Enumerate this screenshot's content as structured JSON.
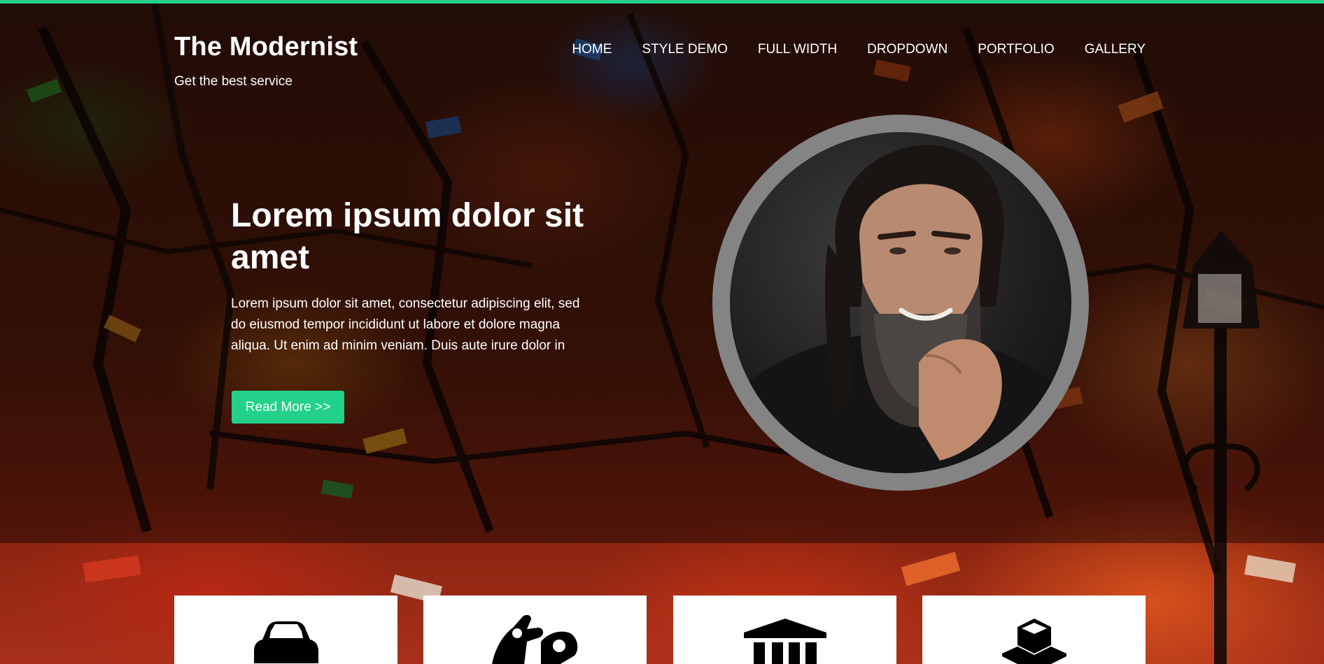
{
  "header": {
    "site_title": "The Modernist",
    "tagline": "Get the best service"
  },
  "nav": {
    "items": [
      "HOME",
      "STYLE DEMO",
      "FULL WIDTH",
      "DROPDOWN",
      "PORTFOLIO",
      "GALLERY"
    ]
  },
  "hero": {
    "heading": "Lorem ipsum dolor sit amet",
    "text": "Lorem ipsum dolor sit amet, consectetur adipiscing elit, sed do eiusmod tempor incididunt ut labore et dolore magna aliqua. Ut enim ad minim veniam. Duis aute irure dolor in",
    "button_label": "Read More >>",
    "portrait_icon": "bearded-man-portrait"
  },
  "features": {
    "cards": [
      {
        "icon": "car-icon"
      },
      {
        "icon": "hand-ok-icon"
      },
      {
        "icon": "bank-icon"
      },
      {
        "icon": "cubes-icon"
      }
    ]
  },
  "colors": {
    "accent": "#23d18b",
    "portrait_ring": "#848484",
    "card_background": "#ffffff"
  }
}
